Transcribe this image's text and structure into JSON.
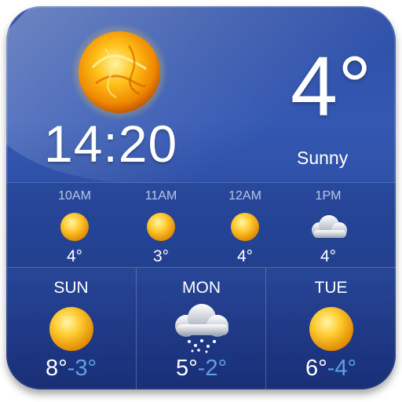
{
  "current": {
    "time": "14:20",
    "temperature": "4°",
    "condition": "Sunny",
    "icon": "sun-icon"
  },
  "hourly": [
    {
      "time": "10AM",
      "icon": "sun-icon",
      "temp": "4°"
    },
    {
      "time": "11AM",
      "icon": "sun-icon",
      "temp": "3°"
    },
    {
      "time": "12AM",
      "icon": "sun-icon",
      "temp": "4°"
    },
    {
      "time": "1PM",
      "icon": "cloud-icon",
      "temp": "4°"
    }
  ],
  "daily": [
    {
      "day": "SUN",
      "icon": "sun-icon",
      "high": "8°",
      "low": "-3°"
    },
    {
      "day": "MON",
      "icon": "snow-cloud-icon",
      "high": "5°",
      "low": "-2°"
    },
    {
      "day": "TUE",
      "icon": "sun-icon",
      "high": "6°",
      "low": "-4°"
    }
  ],
  "colors": {
    "background": "#2c4ea6",
    "text": "#ffffff",
    "low_temp": "#5f9ee6",
    "hour_label": "#b9c6e2"
  }
}
